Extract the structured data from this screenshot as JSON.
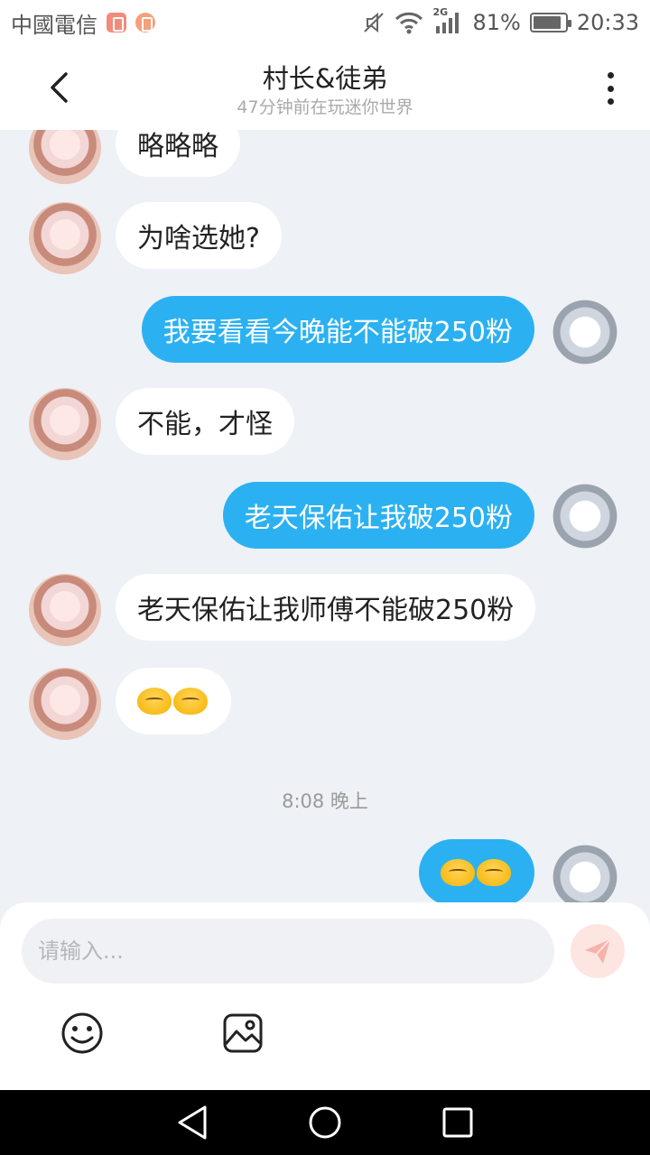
{
  "status_bar": {
    "carrier": "中國電信",
    "battery": "81%",
    "time": "20:33",
    "network": "2G"
  },
  "header": {
    "title": "村长&徒弟",
    "subtitle": "47分钟前在玩迷你世界"
  },
  "messages": [
    {
      "side": "left",
      "text": "略略略"
    },
    {
      "side": "left",
      "text": "为啥选她?"
    },
    {
      "side": "right",
      "text": "我要看看今晚能不能破250粉"
    },
    {
      "side": "left",
      "text": "不能，才怪"
    },
    {
      "side": "right",
      "text": "老天保佑让我破250粉"
    },
    {
      "side": "left",
      "text": "老天保佑让我师傅不能破250粉"
    },
    {
      "side": "left",
      "emoji": "pray-emoji"
    },
    {
      "side": "right",
      "emoji": "angry-emoji"
    }
  ],
  "timestamp": "8:08 晚上",
  "composer": {
    "placeholder": "请输入..."
  },
  "colors": {
    "accent": "#2bb1f1",
    "background": "#eef1f6",
    "send_button": "#fde5e2"
  },
  "icons": [
    "back-arrow-icon",
    "more-vertical-icon",
    "send-icon",
    "smiley-icon",
    "image-icon",
    "nav-back-icon",
    "nav-home-icon",
    "nav-recents-icon"
  ]
}
